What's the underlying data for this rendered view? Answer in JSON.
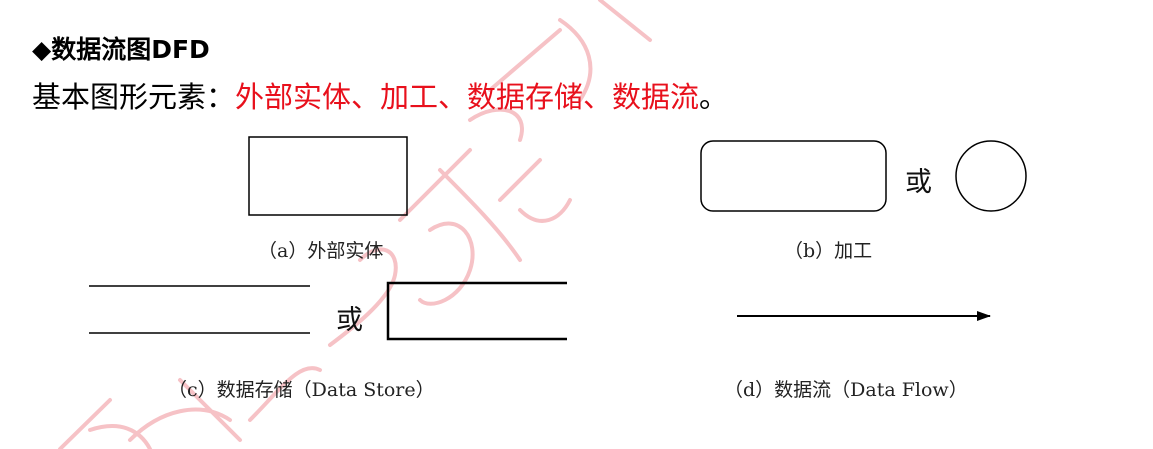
{
  "title": "◆数据流图DFD",
  "subtitle": {
    "prefix": "基本图形元素：",
    "elements": "外部实体、加工、数据存储、数据流",
    "suffix": "。"
  },
  "figures": {
    "external_entity": {
      "caption": "（a）外部实体"
    },
    "process": {
      "caption": "（b）加工",
      "or_label": "或"
    },
    "data_store": {
      "caption": "（c）数据存储（Data Store）",
      "or_label": "或"
    },
    "data_flow": {
      "caption": "（d）数据流（Data Flow）"
    }
  },
  "colors": {
    "highlight": "#e8101c",
    "watermark": "#f4b8bc"
  }
}
